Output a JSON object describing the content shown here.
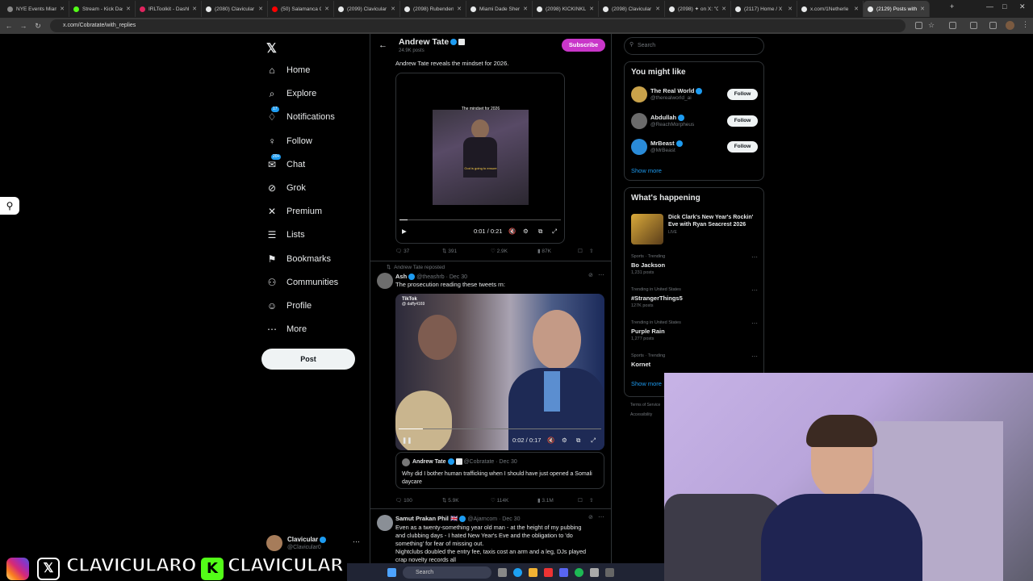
{
  "browser": {
    "tabs": [
      {
        "title": "NYE Events Miami",
        "color": "#888"
      },
      {
        "title": "Stream - Kick Dash",
        "color": "#53fc18"
      },
      {
        "title": "IRLToolkit - Dashb",
        "color": "#e0245e"
      },
      {
        "title": "(2080) Clavicular (",
        "color": "#e7e9ea"
      },
      {
        "title": "(50) Salamanca Ca",
        "color": "#ff0000"
      },
      {
        "title": "(2099) Clavicular (",
        "color": "#e7e9ea"
      },
      {
        "title": "(2098) Rubenden",
        "color": "#e7e9ea"
      },
      {
        "title": "Miami Dade Sheri",
        "color": "#e7e9ea"
      },
      {
        "title": "(2098) KICKINKLI",
        "color": "#e7e9ea"
      },
      {
        "title": "(2098) Clavicular (",
        "color": "#e7e9ea"
      },
      {
        "title": "(2098) ✦ on X: \"C",
        "color": "#e7e9ea"
      },
      {
        "title": "(2117) Home / X",
        "color": "#e7e9ea"
      },
      {
        "title": "x.com/1Netherle",
        "color": "#e7e9ea"
      },
      {
        "title": "(2129) Posts with",
        "color": "#e7e9ea"
      }
    ],
    "url": "x.com/Cobratate/with_replies"
  },
  "sidebar": {
    "items": [
      {
        "label": "Home",
        "icon": "home-icon",
        "glyph": "⌂",
        "badge": ""
      },
      {
        "label": "Explore",
        "icon": "search-icon",
        "glyph": "⌕",
        "badge": ""
      },
      {
        "label": "Notifications",
        "icon": "bell-icon",
        "glyph": "♢",
        "badge": "17"
      },
      {
        "label": "Follow",
        "icon": "person-add-icon",
        "glyph": "♀",
        "badge": ""
      },
      {
        "label": "Chat",
        "icon": "chat-icon",
        "glyph": "✉",
        "badge": "20+"
      },
      {
        "label": "Grok",
        "icon": "grok-icon",
        "glyph": "⊘",
        "badge": ""
      },
      {
        "label": "Premium",
        "icon": "x-logo-icon",
        "glyph": "✕",
        "badge": ""
      },
      {
        "label": "Lists",
        "icon": "list-icon",
        "glyph": "☰",
        "badge": ""
      },
      {
        "label": "Bookmarks",
        "icon": "bookmark-icon",
        "glyph": "⚑",
        "badge": ""
      },
      {
        "label": "Communities",
        "icon": "people-icon",
        "glyph": "⚇",
        "badge": ""
      },
      {
        "label": "Profile",
        "icon": "profile-icon",
        "glyph": "☺",
        "badge": ""
      },
      {
        "label": "More",
        "icon": "more-icon",
        "glyph": "⋯",
        "badge": ""
      }
    ],
    "post_label": "Post",
    "account": {
      "name": "Clavicular",
      "handle": "@Clavicular0"
    }
  },
  "profile_header": {
    "name": "Andrew Tate",
    "posts": "24.9K posts",
    "subscribe_label": "Subscribe"
  },
  "tweet1": {
    "text": "Andrew Tate reveals the mindset for 2026.",
    "video_caption": "The mindset for 2026",
    "video_subtitle": "God is going to ensure",
    "time": "0:01 / 0:21",
    "replies": "37",
    "reposts": "391",
    "likes": "2.9K",
    "views": "87K"
  },
  "tweet2": {
    "repost_label": "Andrew Tate reposted",
    "name": "Ash",
    "handle": "@theashrb",
    "date": "Dec 30",
    "text": "The prosecution reading these tweets rn:",
    "tiktok_label": "TikTok",
    "tiktok_handle": "@ daffy4169",
    "time": "0:02 / 0:17",
    "quote": {
      "name": "Andrew Tate",
      "handle": "@Cobratate",
      "date": "Dec 30",
      "text": "Why did I bother human trafficking when I should have just opened a Somali daycare"
    },
    "replies": "100",
    "reposts": "5.9K",
    "likes": "114K",
    "views": "3.1M"
  },
  "tweet3": {
    "name": "Samut Prakan Phil 🇬🇧",
    "handle": "@Ajarncom",
    "date": "Dec 30",
    "line1": "Even as a twenty-something year old man - at the height of my pubbing",
    "line2": "and clubbing days - I hated New Year's Eve and the obligation to 'do",
    "line3": "something' for fear of missing out.",
    "line4": "Nightclubs doubled the entry fee, taxis cost an arm and a leg, DJs played",
    "line5": "crap novelty records all"
  },
  "right": {
    "search_placeholder": "Search",
    "you_might_like": "You might like",
    "suggestions": [
      {
        "name": "The Real World",
        "handle": "@therealworld_ai",
        "follow": "Follow",
        "avatar": "#c9a24a"
      },
      {
        "name": "Abdullah",
        "handle": "@ReachMorpheus",
        "follow": "Follow",
        "avatar": "#6b6b6b"
      },
      {
        "name": "MrBeast",
        "handle": "@MrBeast",
        "follow": "Follow",
        "avatar": "#2a8bd8"
      }
    ],
    "show_more": "Show more",
    "whats_happening": "What's happening",
    "event": {
      "title_line1": "Dick Clark's New Year's Rockin'",
      "title_line2": "Eve with Ryan Seacrest 2026",
      "status": "LIVE"
    },
    "trends": [
      {
        "category": "Sports · Trending",
        "name": "Bo Jackson",
        "count": "1,231 posts"
      },
      {
        "category": "Trending in United States",
        "name": "#StrangerThings5",
        "count": "127K posts"
      },
      {
        "category": "Trending in United States",
        "name": "Purple Rain",
        "count": "1,277 posts"
      },
      {
        "category": "Sports · Trending",
        "name": "Kornet",
        "count": ""
      }
    ],
    "show_more2": "Show more",
    "footer1": "Terms of Service",
    "footer2": "Accessibility"
  },
  "overlay": {
    "text1": "CLAVICULARO",
    "text2": "CLAVICULAR",
    "taskbar_search": "Search"
  }
}
